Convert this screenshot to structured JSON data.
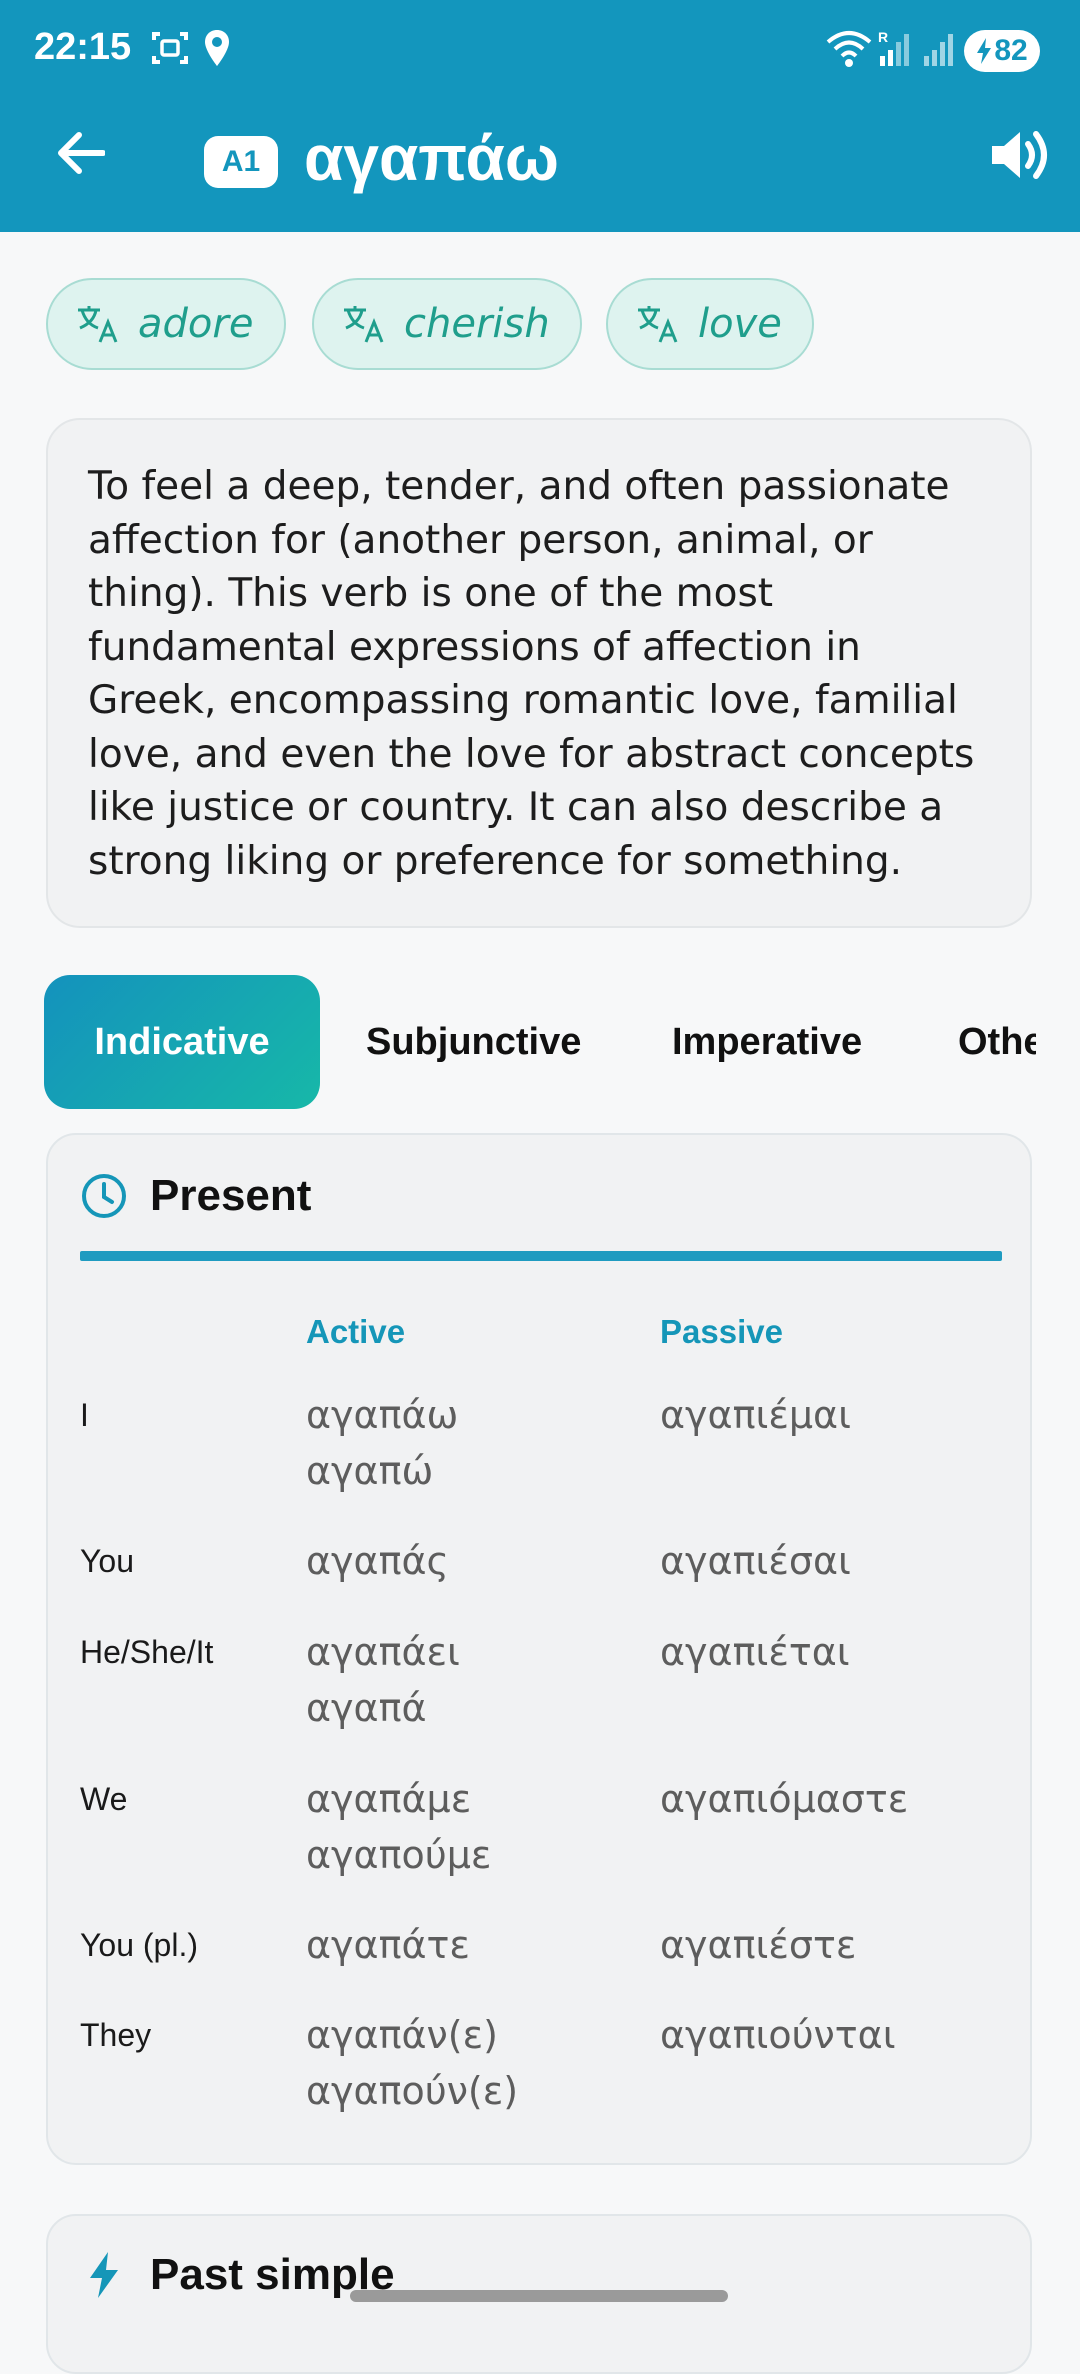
{
  "status_bar": {
    "time": "22:15",
    "battery": "82"
  },
  "header": {
    "level": "A1",
    "word": "αγαπάω"
  },
  "translations": [
    "adore",
    "cherish",
    "love"
  ],
  "definition": "To feel a deep, tender, and often passionate affection for (another person, animal, or thing). This verb is one of the most fundamental expressions of affection in Greek, encompassing romantic love, familial love, and even the love for abstract concepts like justice or country. It can also describe a strong liking or preference for something.",
  "tabs": [
    "Indicative",
    "Subjunctive",
    "Imperative",
    "Other"
  ],
  "present": {
    "title": "Present",
    "col_active": "Active",
    "col_passive": "Passive",
    "rows": [
      {
        "person": "I",
        "active": [
          "αγαπάω",
          "αγαπώ"
        ],
        "passive": [
          "αγαπιέμαι"
        ]
      },
      {
        "person": "You",
        "active": [
          "αγαπάς"
        ],
        "passive": [
          "αγαπιέσαι"
        ]
      },
      {
        "person": "He/She/It",
        "active": [
          "αγαπάει",
          "αγαπά"
        ],
        "passive": [
          "αγαπιέται"
        ]
      },
      {
        "person": "We",
        "active": [
          "αγαπάμε",
          "αγαπούμε"
        ],
        "passive": [
          "αγαπιόμαστε"
        ]
      },
      {
        "person": "You (pl.)",
        "active": [
          "αγαπάτε"
        ],
        "passive": [
          "αγαπιέστε"
        ]
      },
      {
        "person": "They",
        "active": [
          "αγαπάν(ε)",
          "αγαπούν(ε)"
        ],
        "passive": [
          "αγαπιούνται"
        ]
      }
    ]
  },
  "past_simple": {
    "title": "Past simple"
  },
  "colors": {
    "primary": "#1396bd",
    "accent": "#17b8a8",
    "chip_text": "#1f9e8c"
  },
  "icons": {
    "back": "arrow-left-icon",
    "speaker": "volume-icon",
    "translate": "translate-icon",
    "present": "clock-icon",
    "past": "lightning-icon"
  }
}
